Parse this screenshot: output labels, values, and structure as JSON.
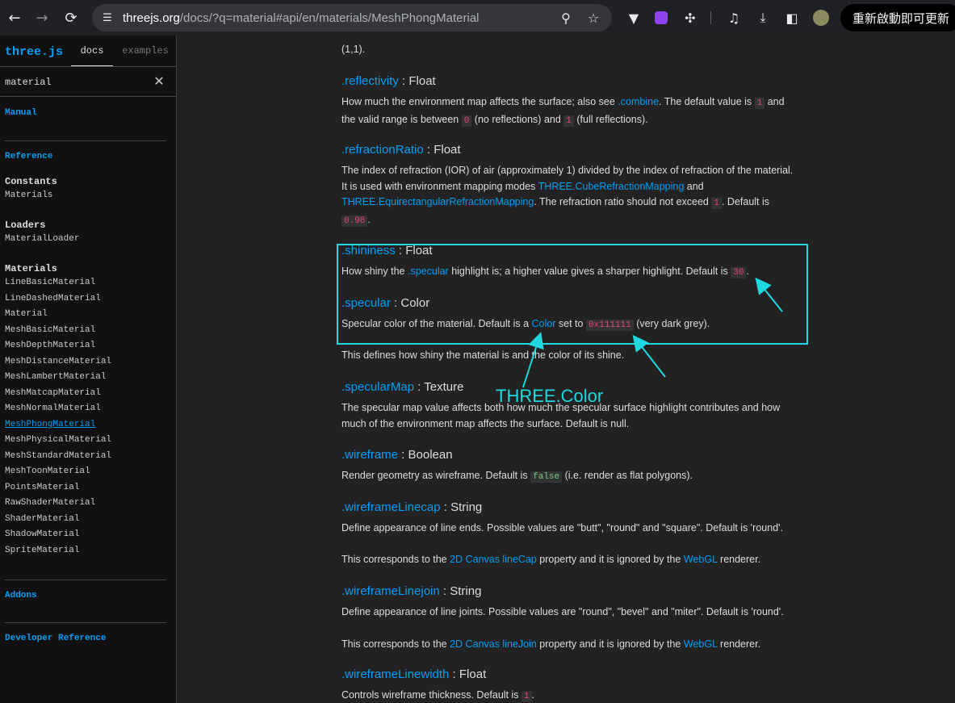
{
  "browser": {
    "url_domain": "threejs.org",
    "url_rest": "/docs/?q=material#api/en/materials/MeshPhongMaterial",
    "update_label": "重新啟動即可更新"
  },
  "sidebar": {
    "logo": "three.js",
    "tab_docs": "docs",
    "tab_examples": "examples",
    "search_value": "material",
    "manual": "Manual",
    "reference": "Reference",
    "constants_title": "Constants",
    "constants_items": [
      "Materials"
    ],
    "loaders_title": "Loaders",
    "loaders_items": [
      "MaterialLoader"
    ],
    "materials_title": "Materials",
    "materials_items": [
      "LineBasicMaterial",
      "LineDashedMaterial",
      "Material",
      "MeshBasicMaterial",
      "MeshDepthMaterial",
      "MeshDistanceMaterial",
      "MeshLambertMaterial",
      "MeshMatcapMaterial",
      "MeshNormalMaterial",
      "MeshPhongMaterial",
      "MeshPhysicalMaterial",
      "MeshStandardMaterial",
      "MeshToonMaterial",
      "PointsMaterial",
      "RawShaderMaterial",
      "ShaderMaterial",
      "ShadowMaterial",
      "SpriteMaterial"
    ],
    "selected_item": "MeshPhongMaterial",
    "addons": "Addons",
    "developer_reference": "Developer Reference"
  },
  "content": {
    "top_partial_text": "(1,1).",
    "reflectivity": {
      "name": ".reflectivity",
      "type": " : Float",
      "d1": "How much the environment map affects the surface; also see ",
      "d_link": ".combine",
      "d2": ". The default value is ",
      "c1": "1",
      "d3": " and the valid range is between ",
      "c2": "0",
      "d4": " (no reflections) and ",
      "c3": "1",
      "d5": " (full reflections)."
    },
    "refractionRatio": {
      "name": ".refractionRatio",
      "type": " : Float",
      "d1": "The index of refraction (IOR) of air (approximately 1) divided by the index of refraction of the material. It is used with environment mapping modes ",
      "l1": "THREE.CubeRefractionMapping",
      "d2": " and ",
      "l2": "THREE.EquirectangularRefractionMapping",
      "d3": ". The refraction ratio should not exceed ",
      "c1": "1",
      "d4": ". Default is ",
      "c2": "0.98",
      "d5": "."
    },
    "shininess": {
      "name": ".shininess",
      "type": " : Float",
      "d1": "How shiny the ",
      "link": ".specular",
      "d2": " highlight is; a higher value gives a sharper highlight. Default is ",
      "c1": "30",
      "d3": "."
    },
    "specular": {
      "name": ".specular",
      "type": " : Color",
      "d1": "Specular color of the material. Default is a ",
      "link": "Color",
      "d2": " set to ",
      "c1": "0x111111",
      "d3": " (very dark grey)."
    },
    "specular_note": "This defines how shiny the material is and the color of its shine.",
    "specularMap": {
      "name": ".specularMap",
      "type": " : Texture",
      "desc": "The specular map value affects both how much the specular surface highlight contributes and how much of the environment map affects the surface. Default is null."
    },
    "wireframe": {
      "name": ".wireframe",
      "type": " : Boolean",
      "d1": "Render geometry as wireframe. Default is ",
      "c1": "false",
      "d2": " (i.e. render as flat polygons)."
    },
    "wireframeLinecap": {
      "name": ".wireframeLinecap",
      "type": " : String",
      "desc": "Define appearance of line ends. Possible values are \"butt\", \"round\" and \"square\". Default is 'round'.",
      "n1": "This corresponds to the ",
      "l1": "2D Canvas lineCap",
      "n2": " property and it is ignored by the ",
      "l2": "WebGL",
      "n3": " renderer."
    },
    "wireframeLinejoin": {
      "name": ".wireframeLinejoin",
      "type": " : String",
      "desc": "Define appearance of line joints. Possible values are \"round\", \"bevel\" and \"miter\". Default is 'round'.",
      "n1": "This corresponds to the ",
      "l1": "2D Canvas lineJoin",
      "n2": " property and it is ignored by the ",
      "l2": "WebGL",
      "n3": " renderer."
    },
    "wireframeLinewidth": {
      "name": ".wireframeLinewidth",
      "type": " : Float",
      "d1": "Controls wireframe thickness. Default is ",
      "c1": "1",
      "d2": "."
    }
  },
  "annotation": {
    "label": "THREE.Color",
    "color": "#20d8e0"
  }
}
